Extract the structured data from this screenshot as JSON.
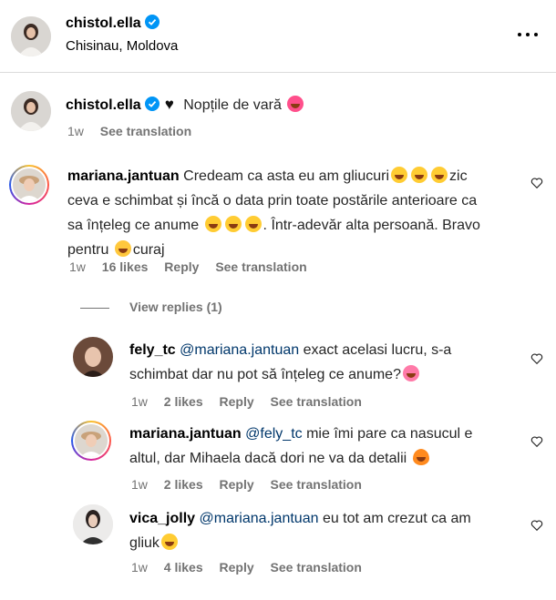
{
  "header": {
    "username": "chistol.ella",
    "location": "Chisinau, Moldova"
  },
  "caption": {
    "username": "chistol.ella",
    "text": "Nopțile de vară",
    "time": "1w",
    "see_translation": "See translation"
  },
  "comments": [
    {
      "username": "mariana.jantuan",
      "line1": "Credeam ca asta eu am gliucuri",
      "line1b": "zic",
      "line2": "ceva e schimbat și încă o data prin toate postările anterioare ca",
      "line3a": "sa înțeleg ce anume",
      "line3b": ". Într-adevăr alta persoană. Bravo",
      "line4a": "pentru",
      "line4b": "curaj",
      "time": "1w",
      "likes": "16 likes",
      "reply": "Reply",
      "see_translation": "See translation"
    }
  ],
  "view_replies": "View replies (1)",
  "replies": [
    {
      "username": "fely_tc",
      "mention": "@mariana.jantuan",
      "line1": "exact acelasi lucru, s-a",
      "line2": "schimbat dar nu pot să înțeleg ce anume?",
      "time": "1w",
      "likes": "2 likes",
      "reply": "Reply",
      "see_translation": "See translation"
    },
    {
      "username": "mariana.jantuan",
      "mention": "@fely_tc",
      "line1": "mie îmi pare ca nasucul e",
      "line2": "altul, dar Mihaela dacă dori ne va da detalii",
      "time": "1w",
      "likes": "2 likes",
      "reply": "Reply",
      "see_translation": "See translation"
    },
    {
      "username": "vica_jolly",
      "mention": "@mariana.jantuan",
      "line1": "eu tot am crezut ca am",
      "line2": "gliuk",
      "time": "1w",
      "likes": "4 likes",
      "reply": "Reply",
      "see_translation": "See translation"
    }
  ],
  "icons": {
    "verified": "verified-badge-icon",
    "more": "more-options-icon",
    "like": "heart-outline-icon"
  },
  "colors": {
    "verified": "#0095f6",
    "meta": "#737373",
    "mention": "#00376b"
  }
}
